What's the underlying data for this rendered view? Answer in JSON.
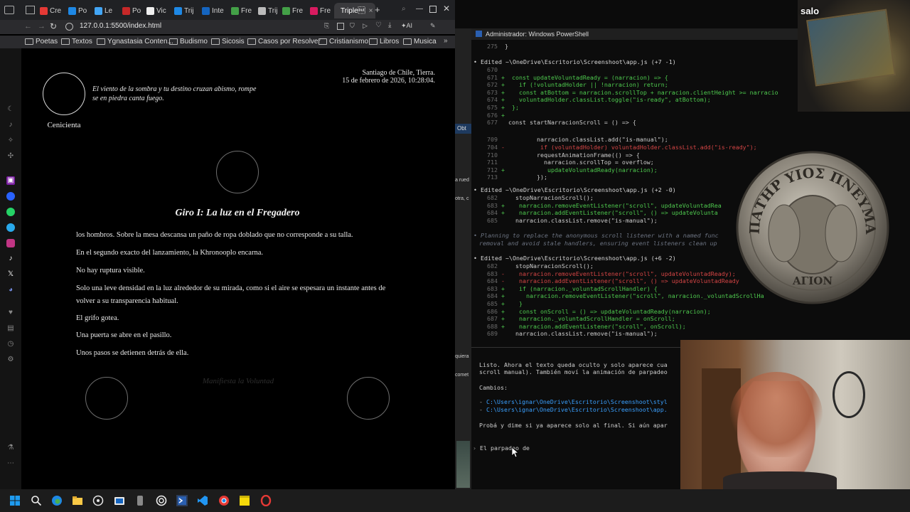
{
  "browser": {
    "tabs": [
      {
        "label": "Cre",
        "icon": "youtube-icon",
        "color": "#e53935"
      },
      {
        "label": "Po",
        "icon": "docs-icon",
        "color": "#1e88e5"
      },
      {
        "label": "Le",
        "icon": "telegram-icon",
        "color": "#42a5f5"
      },
      {
        "label": "Po",
        "icon": "circle-icon",
        "color": "#c62828"
      },
      {
        "label": "Vic",
        "icon": "wikipedia-icon",
        "color": "#eeeeee"
      },
      {
        "label": "Trij",
        "icon": "docs-icon",
        "color": "#1e88e5"
      },
      {
        "label": "Inte",
        "icon": "vscode-icon",
        "color": "#1565c0"
      },
      {
        "label": "Fre",
        "icon": "chatgpt-icon",
        "color": "#43a047"
      },
      {
        "label": "Trij",
        "icon": "page-icon",
        "color": "#bbbbbb"
      },
      {
        "label": "Fre",
        "icon": "chatgpt-icon",
        "color": "#43a047"
      },
      {
        "label": "Fre",
        "icon": "chatgpt-icon",
        "color": "#d81b60"
      }
    ],
    "active_tab": "Triple\u0010",
    "url": "127.0.0.1:5500/index.html",
    "bookmarks": [
      "Poetas",
      "Textos",
      "Ygnastasia Conten...",
      "Budismo",
      "Sicosis",
      "Casos por Resolver",
      "Cristianismo",
      "Libros",
      "Musica"
    ]
  },
  "page": {
    "epigraph": "El viento de la sombra y tu destino cruzan abismo, rompe se en piedra canta fuego.",
    "character_name": "Cenicienta",
    "location": "Santiago de Chile, Tierra.",
    "datetime": "15 de febrero de 2026, 10:28:04.",
    "chapter_title": "Giro I: La luz en el Fregadero",
    "paragraphs": [
      "los hombros. Sobre la mesa descansa un paño de ropa doblado que no corresponde a su talla.",
      "En el segundo exacto del lanzamiento, la Khronooplo encarna.",
      "No hay ruptura visible.",
      "Solo una leve densidad en la luz alrededor de su mirada, como si el aire se espesara un instante antes de volver a su transparencia habitual.",
      "El grifo gotea.",
      "Una puerta se abre en el pasillo.",
      "Unos pasos se detienen detrás de ella."
    ],
    "faded_button": "Manifiesta la Voluntad"
  },
  "terminal": {
    "title": "Administrador: Windows PowerShell",
    "edit1_header": "Edited ~\\OneDrive\\Escritorio\\Screenshoot\\app.js (+7 -1)",
    "edit1_stat_add": "+7",
    "edit1_stat_del": "-1",
    "edit1_lines": [
      {
        "n": "275",
        "s": "",
        "t": "}",
        "k": ""
      },
      {
        "n": "670",
        "s": "",
        "t": "",
        "k": ""
      },
      {
        "n": "671",
        "s": "+",
        "t": "const updateVoluntadReady = (narracion) => {",
        "k": "add"
      },
      {
        "n": "672",
        "s": "+",
        "t": "  if (!voluntadHolder || !narracion) return;",
        "k": "add"
      },
      {
        "n": "673",
        "s": "+",
        "t": "  const atBottom = narracion.scrollTop + narracion.clientHeight >= narracio",
        "k": "add"
      },
      {
        "n": "674",
        "s": "+",
        "t": "  voluntadHolder.classList.toggle(\"is-ready\", atBottom);",
        "k": "add"
      },
      {
        "n": "675",
        "s": "+",
        "t": "};",
        "k": "add"
      },
      {
        "n": "676",
        "s": "+",
        "t": "",
        "k": "add"
      },
      {
        "n": "677",
        "s": "",
        "t": "const startNarracionScroll = () => {",
        "k": ""
      },
      {
        "n": "",
        "s": "",
        "t": "",
        "k": ""
      },
      {
        "n": "709",
        "s": "",
        "t": "        narracion.classList.add(\"is-manual\");",
        "k": ""
      },
      {
        "n": "704",
        "s": "-",
        "t": "        if (voluntadHolder) voluntadHolder.classList.add(\"is-ready\");",
        "k": "del"
      },
      {
        "n": "710",
        "s": "",
        "t": "        requestAnimationFrame(() => {",
        "k": ""
      },
      {
        "n": "711",
        "s": "",
        "t": "          narracion.scrollTop = overflow;",
        "k": ""
      },
      {
        "n": "712",
        "s": "+",
        "t": "          updateVoluntadReady(narracion);",
        "k": "add"
      },
      {
        "n": "713",
        "s": "",
        "t": "        });",
        "k": ""
      }
    ],
    "edit2_header": "Edited ~\\OneDrive\\Escritorio\\Screenshoot\\app.js (+2 -0)",
    "edit2_lines": [
      {
        "n": "682",
        "s": "",
        "t": "  stopNarracionScroll();",
        "k": ""
      },
      {
        "n": "683",
        "s": "+",
        "t": "  narracion.removeEventListener(\"scroll\", updateVoluntadRea",
        "k": "add"
      },
      {
        "n": "684",
        "s": "+",
        "t": "  narracion.addEventListener(\"scroll\", () => updateVolunta",
        "k": "add"
      },
      {
        "n": "685",
        "s": "",
        "t": "  narracion.classList.remove(\"is-manual\");",
        "k": ""
      }
    ],
    "planning_note": "Planning to replace the anonymous scroll listener with a named func",
    "planning_note2": "removal and avoid stale handlers, ensuring event listeners clean up",
    "edit3_header": "Edited ~\\OneDrive\\Escritorio\\Screenshoot\\app.js (+6 -2)",
    "edit3_lines": [
      {
        "n": "682",
        "s": "",
        "t": "  stopNarracionScroll();",
        "k": ""
      },
      {
        "n": "683",
        "s": "-",
        "t": "  narracion.removeEventListener(\"scroll\", updateVoluntadReady);",
        "k": "del"
      },
      {
        "n": "684",
        "s": "-",
        "t": "  narracion.addEventListener(\"scroll\", () => updateVoluntadReady",
        "k": "del"
      },
      {
        "n": "683",
        "s": "+",
        "t": "  if (narracion._voluntadScrollHandler) {",
        "k": "add"
      },
      {
        "n": "684",
        "s": "+",
        "t": "    narracion.removeEventListener(\"scroll\", narracion._voluntadScrollHa",
        "k": "add"
      },
      {
        "n": "685",
        "s": "+",
        "t": "  }",
        "k": "add"
      },
      {
        "n": "686",
        "s": "+",
        "t": "  const onScroll = () => updateVoluntadReady(narracion);",
        "k": "add"
      },
      {
        "n": "687",
        "s": "+",
        "t": "  narracion._voluntadScrollHandler = onScroll;",
        "k": "add"
      },
      {
        "n": "688",
        "s": "+",
        "t": "  narracion.addEventListener(\"scroll\", onScroll);",
        "k": "add"
      },
      {
        "n": "689",
        "s": "",
        "t": "  narracion.classList.remove(\"is-manual\");",
        "k": ""
      }
    ],
    "summary1": "Listo. Ahora el texto queda oculto y solo aparece cua",
    "summary2": "scroll manual). También moví la animación de parpadeo",
    "changes_label": "Cambios:",
    "change_paths": [
      "C:\\Users\\ignar\\OneDrive\\Escritorio\\Screenshoot\\styl",
      "C:\\Users\\ignar\\OneDrive\\Escritorio\\Screenshoot\\app."
    ],
    "followup": "Probá y dime si ya aparece solo al final. Si aún apar",
    "prompt_input": "El parpadeo de"
  },
  "side_fragments": [
    "Obt",
    "a rued",
    "otra, c",
    "quiera",
    "comet"
  ],
  "overlay": {
    "stream_label": "salo",
    "coin_text_top": "ΠΑΤΗΡ ΥΙΟΣ ΠΝΕΥΜΑ",
    "coin_text_bottom": "ΑΓΙΟΝ"
  },
  "taskbar": {
    "icons": [
      "windows-start-icon",
      "search-icon",
      "edge-icon",
      "file-explorer-icon",
      "whatsapp-icon",
      "store-icon",
      "remote-icon",
      "chatgpt-icon",
      "powershell-icon",
      "vscode-icon",
      "chrome-icon",
      "sticky-notes-icon",
      "opera-icon"
    ]
  }
}
